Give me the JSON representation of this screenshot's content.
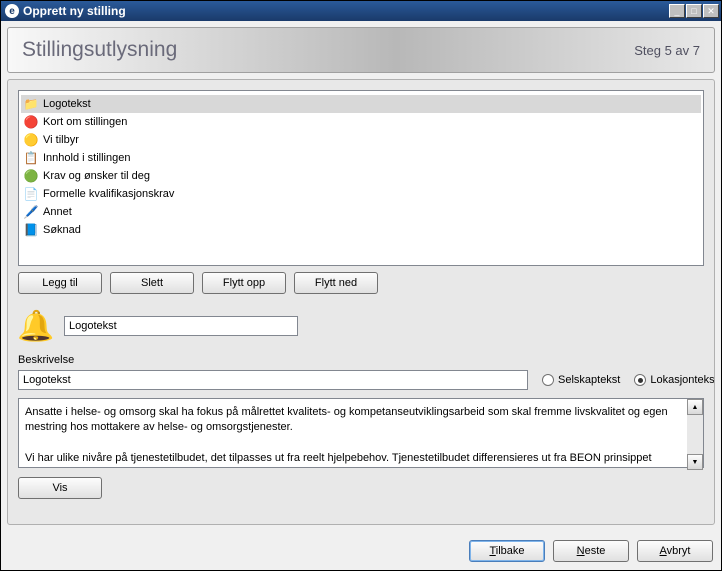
{
  "window": {
    "title": "Opprett ny stilling"
  },
  "header": {
    "title": "Stillingsutlysning",
    "step": "Steg 5 av 7"
  },
  "list": {
    "items": [
      {
        "label": "Logotekst",
        "icon": "📁",
        "selected": true
      },
      {
        "label": "Kort om stillingen",
        "icon": "🔴",
        "selected": false
      },
      {
        "label": "Vi tilbyr",
        "icon": "🟡",
        "selected": false
      },
      {
        "label": "Innhold i stillingen",
        "icon": "📋",
        "selected": false
      },
      {
        "label": "Krav og ønsker til deg",
        "icon": "🟢",
        "selected": false
      },
      {
        "label": "Formelle kvalifikasjonskrav",
        "icon": "📄",
        "selected": false
      },
      {
        "label": "Annet",
        "icon": "🖊️",
        "selected": false
      },
      {
        "label": "Søknad",
        "icon": "📘",
        "selected": false
      }
    ]
  },
  "list_buttons": {
    "add": "Legg til",
    "delete": "Slett",
    "move_up": "Flytt opp",
    "move_down": "Flytt ned"
  },
  "section": {
    "title_value": "Logotekst",
    "desc_label": "Beskrivelse",
    "desc_value": "Logotekst",
    "radio_company": "Selskaptekst",
    "radio_location": "Lokasjontekst",
    "textarea": "Ansatte i helse- og omsorg skal ha fokus på målrettet kvalitets- og kompetanseutviklingsarbeid som skal fremme livskvalitet og egen mestring hos mottakere av helse- og omsorgstjenester.\n\nVi har ulike nivåre på tjenestetilbudet, det tilpasses ut fra reelt hjelpebehov. Tjenestetilbudet differensieres ut fra BEON prinsippet",
    "show_btn": "Vis"
  },
  "footer": {
    "back": "Tilbake",
    "next": "Neste",
    "cancel": "Avbryt"
  }
}
